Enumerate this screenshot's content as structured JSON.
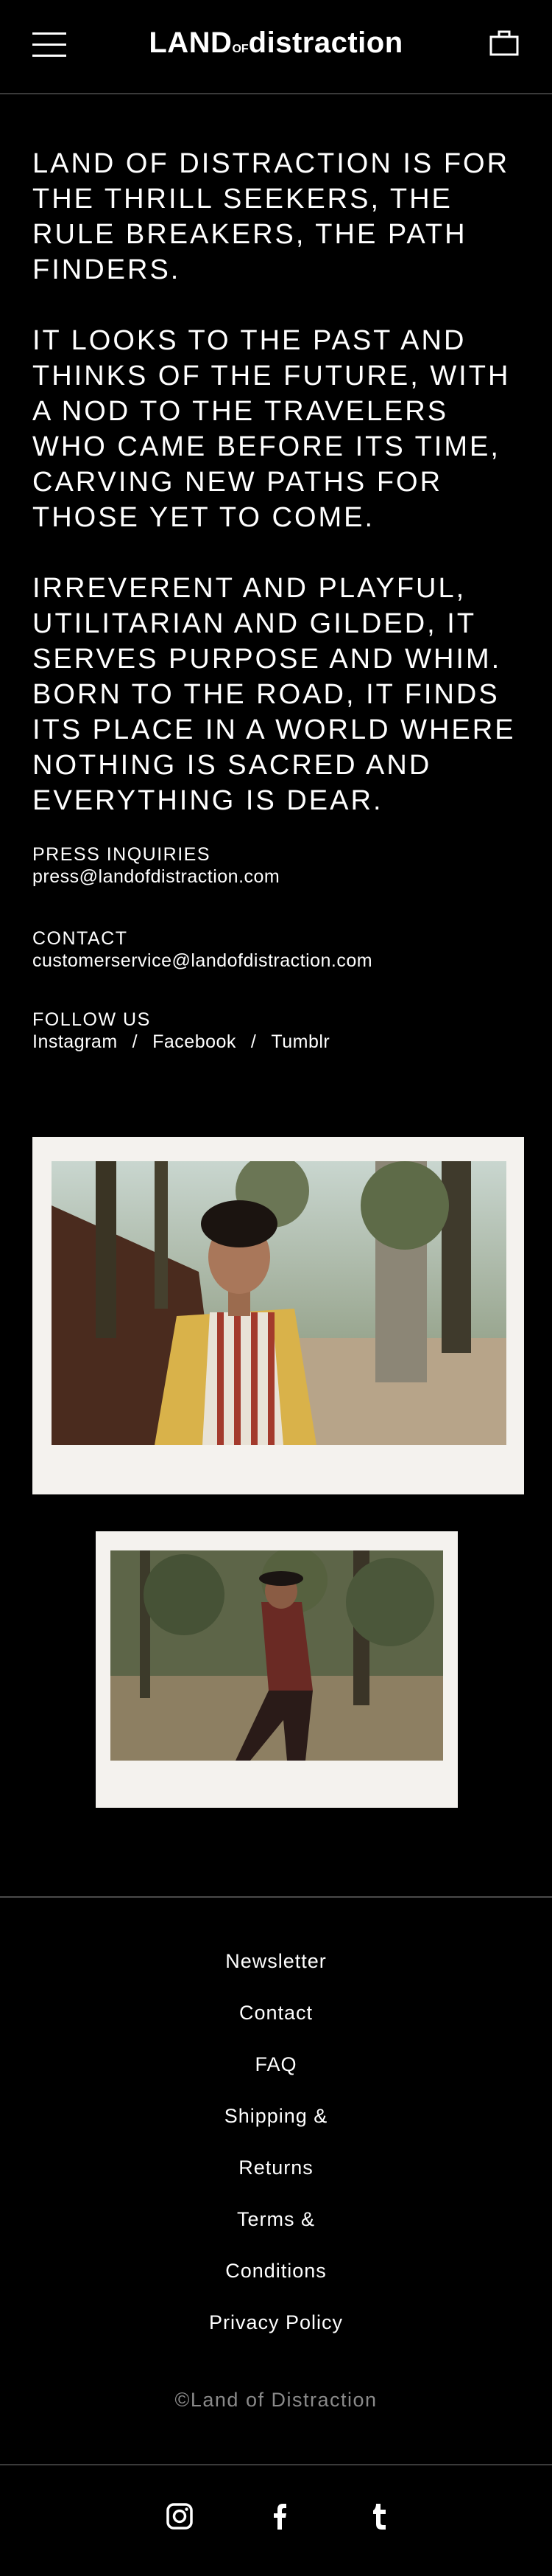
{
  "header": {
    "logo_part1": "LAND",
    "logo_part2": "OF",
    "logo_part3": "distraction",
    "menu_icon": "hamburger-icon",
    "cart_icon": "bag-icon"
  },
  "intro": {
    "paragraph1": "LAND OF DISTRACTION IS FOR THE THRILL SEEKERS, THE RULE BREAKERS, THE PATH FINDERS.",
    "paragraph2": "IT LOOKS TO THE PAST AND THINKS OF THE FUTURE, WITH A NOD TO THE TRAVELERS WHO CAME BEFORE ITS TIME, CARVING NEW PATHS FOR THOSE YET TO COME.",
    "paragraph3": "IRREVERENT AND PLAYFUL, UTILITARIAN AND GILDED, IT SERVES PURPOSE AND WHIM. BORN TO THE ROAD, IT FINDS ITS PLACE IN A WORLD WHERE NOTHING IS SACRED AND EVERYTHING IS DEAR."
  },
  "press": {
    "label": "PRESS INQUIRIES",
    "email": "press@landofdistraction.com"
  },
  "contact": {
    "label": "CONTACT",
    "email": "customerservice@landofdistraction.com"
  },
  "follow": {
    "label": "FOLLOW US",
    "instagram": "Instagram",
    "facebook": "Facebook",
    "tumblr": "Tumblr",
    "separator": "/"
  },
  "footer": {
    "links": [
      "Newsletter",
      "Contact",
      "FAQ",
      "Shipping &",
      "Returns",
      "Terms &",
      "Conditions",
      "Privacy Policy"
    ],
    "copyright": "©Land of Distraction",
    "social_icons": [
      "instagram-icon",
      "facebook-icon",
      "tumblr-icon"
    ]
  },
  "colors": {
    "background": "#000000",
    "text": "#ffffff",
    "muted": "#8a8a8a",
    "polaroid_frame": "#f4f2ee"
  }
}
